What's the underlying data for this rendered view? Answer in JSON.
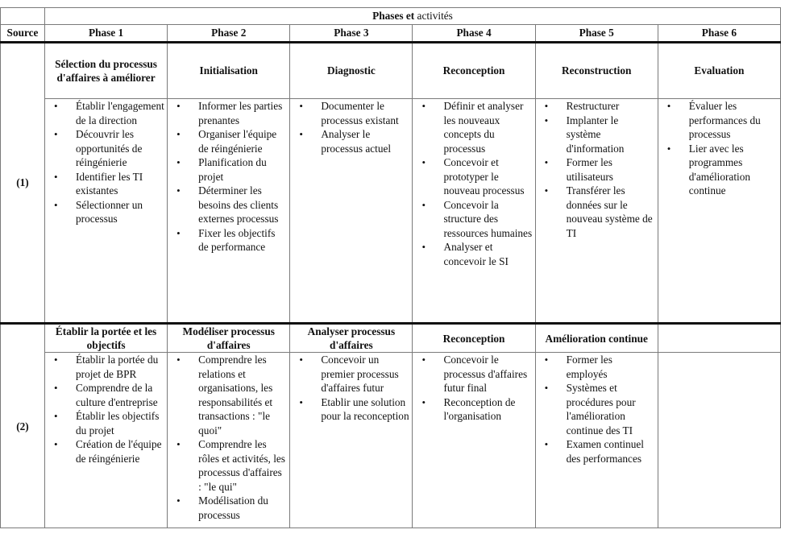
{
  "table": {
    "title_bold": "Phases et",
    "title_rest": " activités",
    "source_header": "Source",
    "phase_headers": [
      "Phase 1",
      "Phase 2",
      "Phase 3",
      "Phase 4",
      "Phase 5",
      "Phase 6"
    ],
    "rows": [
      {
        "source": "(1)",
        "phase_names": [
          "Sélection du processus d'affaires à améliorer",
          "Initialisation",
          "Diagnostic",
          "Reconception",
          "Reconstruction",
          "Evaluation"
        ],
        "activities": [
          [
            "Établir l'engagement de la direction",
            "Découvrir les opportunités de réingénierie",
            "Identifier les TI existantes",
            "Sélectionner un processus"
          ],
          [
            "Informer les parties prenantes",
            "Organiser l'équipe de réingénierie",
            "Planification du projet",
            "Déterminer les besoins des clients externes processus",
            "Fixer les objectifs de performance"
          ],
          [
            "Documenter le processus existant",
            "Analyser le processus actuel"
          ],
          [
            "Définir et analyser les nouveaux concepts du processus",
            "Concevoir et prototyper  le nouveau processus",
            "Concevoir la structure des ressources humaines",
            "Analyser et concevoir le SI"
          ],
          [
            "Restructurer",
            "Implanter le système d'information",
            "Former les utilisateurs",
            "Transférer les données sur le nouveau système de TI"
          ],
          [
            "Évaluer les performances du processus",
            "Lier avec les programmes d'amélioration continue"
          ]
        ]
      },
      {
        "source": "(2)",
        "phase_names": [
          "Établir la portée et les objectifs",
          "Modéliser processus d'affaires",
          "Analyser processus d'affaires",
          "Reconception",
          "Amélioration continue",
          ""
        ],
        "activities": [
          [
            "Établir la portée du projet de BPR",
            "Comprendre de la culture d'entreprise",
            "Établir les objectifs du projet",
            "Création de l'équipe de réingénierie"
          ],
          [
            "Comprendre les relations et organisations, les responsabilités et transactions : \"le quoi\"",
            "Comprendre les rôles et activités, les processus d'affaires : \"le qui\"",
            "Modélisation du processus"
          ],
          [
            "Concevoir un premier processus d'affaires futur",
            "Etablir une solution pour la reconception"
          ],
          [
            "Concevoir le processus d'affaires futur final",
            "Reconception de l'organisation"
          ],
          [
            "Former les employés",
            "Systèmes et procédures pour l'amélioration continue des TI",
            "Examen continuel des performances"
          ],
          []
        ]
      }
    ]
  }
}
